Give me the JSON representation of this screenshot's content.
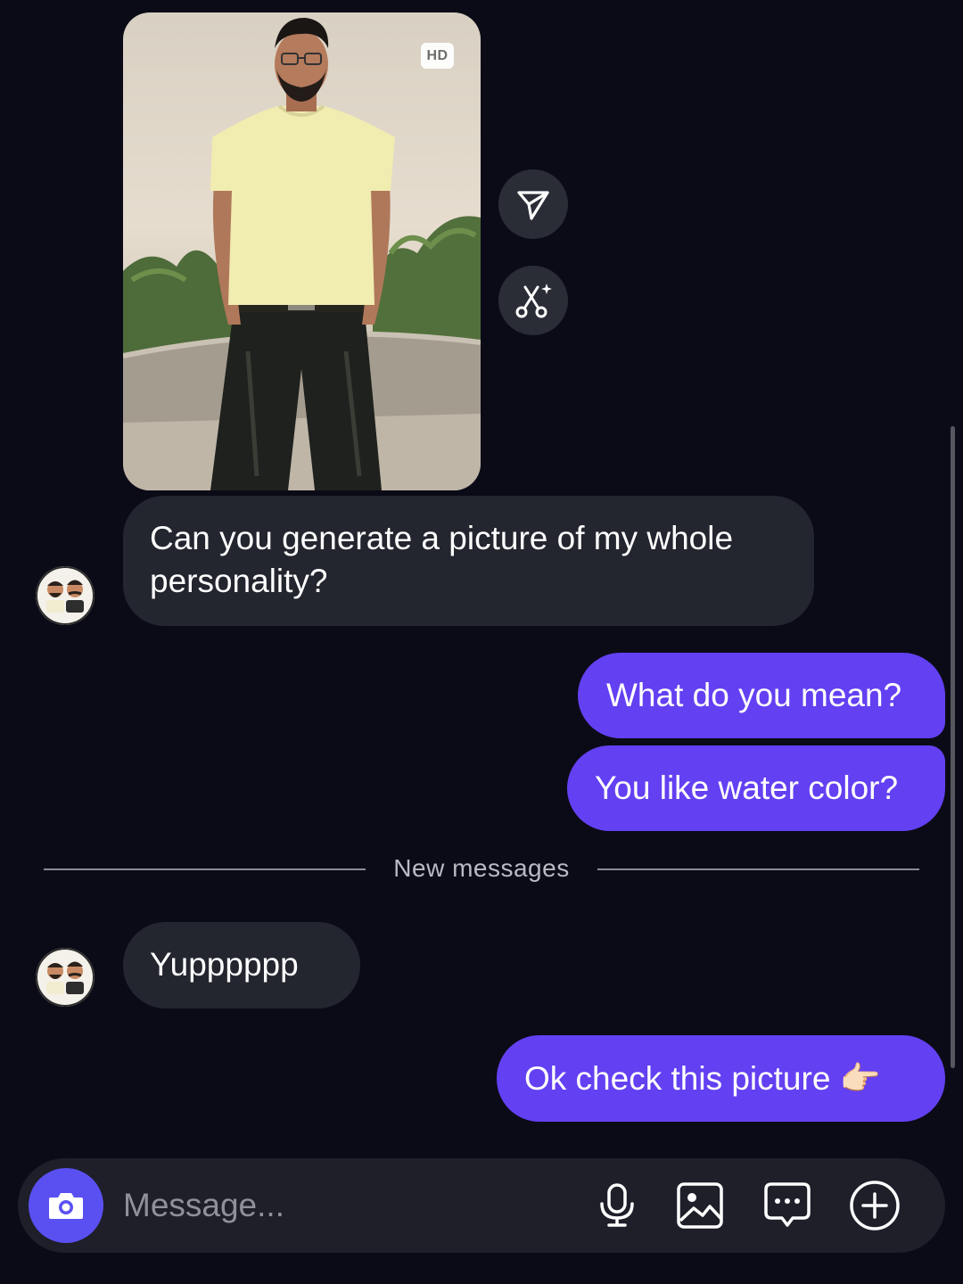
{
  "photo_message": {
    "hd_badge": "HD",
    "actions": [
      {
        "icon": "share-icon"
      },
      {
        "icon": "ai-restyle-icon"
      }
    ]
  },
  "messages": [
    {
      "direction": "incoming",
      "text_line1": "Can you generate a picture of my whole",
      "text_line2": "personality?"
    },
    {
      "direction": "outgoing",
      "text": "What do you mean?"
    },
    {
      "direction": "outgoing",
      "text": "You like water color?"
    },
    {
      "direction": "incoming",
      "text": "Yupppppp"
    },
    {
      "direction": "outgoing",
      "text": "Ok check this picture 👉🏻"
    }
  ],
  "divider": {
    "label": "New messages"
  },
  "composer": {
    "placeholder": "Message...",
    "tools": [
      "microphone-icon",
      "gallery-icon",
      "sticker-icon",
      "add-icon"
    ]
  },
  "colors": {
    "background": "#0b0b17",
    "incoming_bubble": "#23252f",
    "outgoing_bubble": "#6340f2",
    "camera_button": "#5a50f2",
    "composer": "#1e1f29"
  }
}
